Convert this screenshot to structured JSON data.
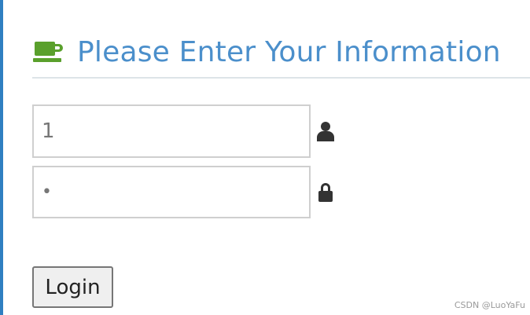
{
  "header": {
    "title": "Please Enter Your Information",
    "icon": "coffee-cup-icon"
  },
  "form": {
    "username": {
      "value": "1",
      "icon": "user-icon"
    },
    "password": {
      "value": "•",
      "icon": "lock-icon"
    },
    "login_label": "Login"
  },
  "watermark": "CSDN @LuoYaFu",
  "colors": {
    "accent": "#2f7fc1",
    "title": "#4b8fcb",
    "cup_icon": "#5aa02c",
    "rule": "#dde4e8"
  }
}
